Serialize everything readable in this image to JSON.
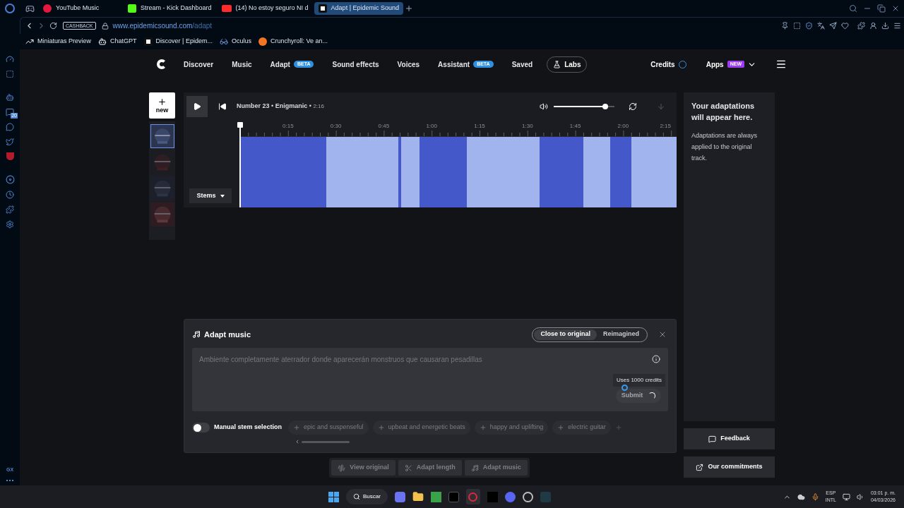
{
  "browser": {
    "tabs": [
      {
        "label": "YouTube Music",
        "kind": "music",
        "selected": false
      },
      {
        "label": "Stream - Kick Dashboard",
        "kind": "kick",
        "selected": false
      },
      {
        "label": "(14) No estoy seguro NI d",
        "kind": "video",
        "selected": false
      },
      {
        "label": "Adapt | Epidemic Sound",
        "kind": "epidemic",
        "selected": true
      }
    ],
    "cashback": "CASHBACK",
    "url_domain": "www.epidemicsound.com",
    "url_path": "/adapt",
    "bookmarks": [
      {
        "label": "Miniaturas Preview",
        "kind": "trend"
      },
      {
        "label": "ChatGPT",
        "kind": "chatgpt"
      },
      {
        "label": "Discover | Epidem...",
        "kind": "epidemic"
      },
      {
        "label": "Oculus",
        "kind": "oculus"
      },
      {
        "label": "Crunchyroll: Ve an...",
        "kind": "crunchyroll"
      }
    ],
    "sidebar_badge": "20",
    "sidebar_footer": "GX"
  },
  "nav": {
    "items": [
      {
        "label": "Discover"
      },
      {
        "label": "Music"
      },
      {
        "label": "Adapt",
        "badge": "BETA"
      },
      {
        "label": "Sound effects"
      },
      {
        "label": "Voices"
      },
      {
        "label": "Assistant",
        "badge": "BETA"
      },
      {
        "label": "Saved"
      }
    ],
    "labs": "Labs",
    "credits": "Credits",
    "apps": "Apps",
    "apps_badge": "NEW"
  },
  "new_button": "new",
  "thumbnails": [
    {
      "selected": true
    },
    {
      "selected": false
    },
    {
      "selected": false
    },
    {
      "selected": false
    }
  ],
  "player": {
    "title": "Number 23",
    "separator": "•",
    "artist": "Enigmanic",
    "separator_2": "•",
    "duration": "2:16",
    "volume": {
      "level": 0.85
    },
    "ruler": [
      "0:15",
      "0:30",
      "0:45",
      "1:00",
      "1:15",
      "1:30",
      "1:45",
      "2:00",
      "2:15"
    ],
    "segments": [
      {
        "kind": "dark"
      },
      {
        "kind": "light"
      },
      {
        "kind": "dark"
      },
      {
        "kind": "light"
      },
      {
        "kind": "dark"
      },
      {
        "kind": "light"
      },
      {
        "kind": "dark"
      },
      {
        "kind": "light"
      },
      {
        "kind": "dark"
      },
      {
        "kind": "light"
      }
    ],
    "stems": "Stems"
  },
  "adaptations": {
    "title": "Your adaptations will appear here.",
    "text": "Adaptations are always applied to the original track."
  },
  "adapt_panel": {
    "title": "Adapt music",
    "modes": [
      {
        "label": "Close to original",
        "selected": true
      },
      {
        "label": "Reimagined",
        "selected": false
      }
    ],
    "prompt": {
      "placeholder": "Ambiente completamente aterrador donde aparecerán monstruos que causaran pesadillas"
    },
    "tooltip": "Uses 1000 credits",
    "submit": {
      "label": "Submit",
      "loading": true
    },
    "manual_stems": {
      "label": "Manual stem selection",
      "on": false
    },
    "suggestions": [
      "epic and suspenseful",
      "upbeat and energetic beats",
      "happy and uplifting",
      "electric guitar"
    ]
  },
  "toolbar": [
    {
      "label": "View original",
      "kind": "wave",
      "disabled": true
    },
    {
      "label": "Adapt length",
      "kind": "scissors",
      "disabled": true
    },
    {
      "label": "Adapt music",
      "kind": "music",
      "disabled": true
    }
  ],
  "feedback": "Feedback",
  "commitments": "Our commitments",
  "taskbar": {
    "search": "Buscar",
    "language": "ESP",
    "layout": "INTL",
    "time": "03:01 p. m.",
    "date": "04/03/2026"
  }
}
